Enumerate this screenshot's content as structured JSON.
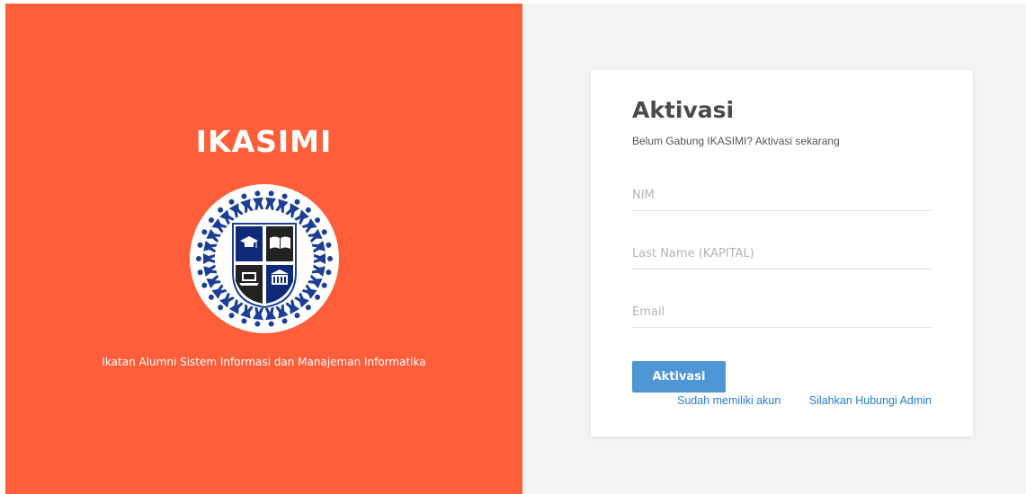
{
  "brand": {
    "name": "IKASIMI",
    "tagline": "Ikatan Alumni Sistem Informasi dan Manajeman Informatika",
    "accent_color": "#ff5e3a"
  },
  "form": {
    "title": "Aktivasi",
    "subtitle": "Belum Gabung IKASIMI? Aktivasi sekarang",
    "fields": {
      "nim": {
        "placeholder": "NIM",
        "value": ""
      },
      "last_name": {
        "placeholder": "Last Name (KAPITAL)",
        "value": ""
      },
      "email": {
        "placeholder": "Email",
        "value": ""
      }
    },
    "submit_label": "Aktivasi",
    "button_color": "#4e96d4",
    "links": {
      "login": "Sudah memiliki akun",
      "admin": "Silahkan Hubungi Admin"
    },
    "link_color": "#2a7fc9"
  },
  "icons": {
    "logo": "ikasimi-emblem-icon",
    "quadrants": [
      "graduation-cap-icon",
      "open-book-icon",
      "laptop-icon",
      "building-icon"
    ]
  }
}
